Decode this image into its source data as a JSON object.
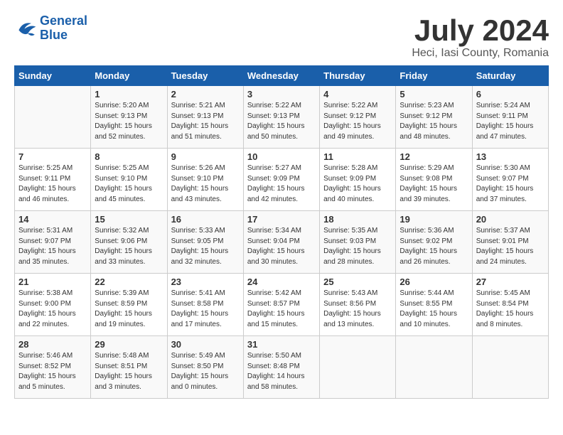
{
  "logo": {
    "line1": "General",
    "line2": "Blue"
  },
  "title": "July 2024",
  "subtitle": "Heci, Iasi County, Romania",
  "header_days": [
    "Sunday",
    "Monday",
    "Tuesday",
    "Wednesday",
    "Thursday",
    "Friday",
    "Saturday"
  ],
  "weeks": [
    [
      {
        "day": "",
        "sunrise": "",
        "sunset": "",
        "daylight": ""
      },
      {
        "day": "1",
        "sunrise": "Sunrise: 5:20 AM",
        "sunset": "Sunset: 9:13 PM",
        "daylight": "Daylight: 15 hours and 52 minutes."
      },
      {
        "day": "2",
        "sunrise": "Sunrise: 5:21 AM",
        "sunset": "Sunset: 9:13 PM",
        "daylight": "Daylight: 15 hours and 51 minutes."
      },
      {
        "day": "3",
        "sunrise": "Sunrise: 5:22 AM",
        "sunset": "Sunset: 9:13 PM",
        "daylight": "Daylight: 15 hours and 50 minutes."
      },
      {
        "day": "4",
        "sunrise": "Sunrise: 5:22 AM",
        "sunset": "Sunset: 9:12 PM",
        "daylight": "Daylight: 15 hours and 49 minutes."
      },
      {
        "day": "5",
        "sunrise": "Sunrise: 5:23 AM",
        "sunset": "Sunset: 9:12 PM",
        "daylight": "Daylight: 15 hours and 48 minutes."
      },
      {
        "day": "6",
        "sunrise": "Sunrise: 5:24 AM",
        "sunset": "Sunset: 9:11 PM",
        "daylight": "Daylight: 15 hours and 47 minutes."
      }
    ],
    [
      {
        "day": "7",
        "sunrise": "Sunrise: 5:25 AM",
        "sunset": "Sunset: 9:11 PM",
        "daylight": "Daylight: 15 hours and 46 minutes."
      },
      {
        "day": "8",
        "sunrise": "Sunrise: 5:25 AM",
        "sunset": "Sunset: 9:10 PM",
        "daylight": "Daylight: 15 hours and 45 minutes."
      },
      {
        "day": "9",
        "sunrise": "Sunrise: 5:26 AM",
        "sunset": "Sunset: 9:10 PM",
        "daylight": "Daylight: 15 hours and 43 minutes."
      },
      {
        "day": "10",
        "sunrise": "Sunrise: 5:27 AM",
        "sunset": "Sunset: 9:09 PM",
        "daylight": "Daylight: 15 hours and 42 minutes."
      },
      {
        "day": "11",
        "sunrise": "Sunrise: 5:28 AM",
        "sunset": "Sunset: 9:09 PM",
        "daylight": "Daylight: 15 hours and 40 minutes."
      },
      {
        "day": "12",
        "sunrise": "Sunrise: 5:29 AM",
        "sunset": "Sunset: 9:08 PM",
        "daylight": "Daylight: 15 hours and 39 minutes."
      },
      {
        "day": "13",
        "sunrise": "Sunrise: 5:30 AM",
        "sunset": "Sunset: 9:07 PM",
        "daylight": "Daylight: 15 hours and 37 minutes."
      }
    ],
    [
      {
        "day": "14",
        "sunrise": "Sunrise: 5:31 AM",
        "sunset": "Sunset: 9:07 PM",
        "daylight": "Daylight: 15 hours and 35 minutes."
      },
      {
        "day": "15",
        "sunrise": "Sunrise: 5:32 AM",
        "sunset": "Sunset: 9:06 PM",
        "daylight": "Daylight: 15 hours and 33 minutes."
      },
      {
        "day": "16",
        "sunrise": "Sunrise: 5:33 AM",
        "sunset": "Sunset: 9:05 PM",
        "daylight": "Daylight: 15 hours and 32 minutes."
      },
      {
        "day": "17",
        "sunrise": "Sunrise: 5:34 AM",
        "sunset": "Sunset: 9:04 PM",
        "daylight": "Daylight: 15 hours and 30 minutes."
      },
      {
        "day": "18",
        "sunrise": "Sunrise: 5:35 AM",
        "sunset": "Sunset: 9:03 PM",
        "daylight": "Daylight: 15 hours and 28 minutes."
      },
      {
        "day": "19",
        "sunrise": "Sunrise: 5:36 AM",
        "sunset": "Sunset: 9:02 PM",
        "daylight": "Daylight: 15 hours and 26 minutes."
      },
      {
        "day": "20",
        "sunrise": "Sunrise: 5:37 AM",
        "sunset": "Sunset: 9:01 PM",
        "daylight": "Daylight: 15 hours and 24 minutes."
      }
    ],
    [
      {
        "day": "21",
        "sunrise": "Sunrise: 5:38 AM",
        "sunset": "Sunset: 9:00 PM",
        "daylight": "Daylight: 15 hours and 22 minutes."
      },
      {
        "day": "22",
        "sunrise": "Sunrise: 5:39 AM",
        "sunset": "Sunset: 8:59 PM",
        "daylight": "Daylight: 15 hours and 19 minutes."
      },
      {
        "day": "23",
        "sunrise": "Sunrise: 5:41 AM",
        "sunset": "Sunset: 8:58 PM",
        "daylight": "Daylight: 15 hours and 17 minutes."
      },
      {
        "day": "24",
        "sunrise": "Sunrise: 5:42 AM",
        "sunset": "Sunset: 8:57 PM",
        "daylight": "Daylight: 15 hours and 15 minutes."
      },
      {
        "day": "25",
        "sunrise": "Sunrise: 5:43 AM",
        "sunset": "Sunset: 8:56 PM",
        "daylight": "Daylight: 15 hours and 13 minutes."
      },
      {
        "day": "26",
        "sunrise": "Sunrise: 5:44 AM",
        "sunset": "Sunset: 8:55 PM",
        "daylight": "Daylight: 15 hours and 10 minutes."
      },
      {
        "day": "27",
        "sunrise": "Sunrise: 5:45 AM",
        "sunset": "Sunset: 8:54 PM",
        "daylight": "Daylight: 15 hours and 8 minutes."
      }
    ],
    [
      {
        "day": "28",
        "sunrise": "Sunrise: 5:46 AM",
        "sunset": "Sunset: 8:52 PM",
        "daylight": "Daylight: 15 hours and 5 minutes."
      },
      {
        "day": "29",
        "sunrise": "Sunrise: 5:48 AM",
        "sunset": "Sunset: 8:51 PM",
        "daylight": "Daylight: 15 hours and 3 minutes."
      },
      {
        "day": "30",
        "sunrise": "Sunrise: 5:49 AM",
        "sunset": "Sunset: 8:50 PM",
        "daylight": "Daylight: 15 hours and 0 minutes."
      },
      {
        "day": "31",
        "sunrise": "Sunrise: 5:50 AM",
        "sunset": "Sunset: 8:48 PM",
        "daylight": "Daylight: 14 hours and 58 minutes."
      },
      {
        "day": "",
        "sunrise": "",
        "sunset": "",
        "daylight": ""
      },
      {
        "day": "",
        "sunrise": "",
        "sunset": "",
        "daylight": ""
      },
      {
        "day": "",
        "sunrise": "",
        "sunset": "",
        "daylight": ""
      }
    ]
  ]
}
